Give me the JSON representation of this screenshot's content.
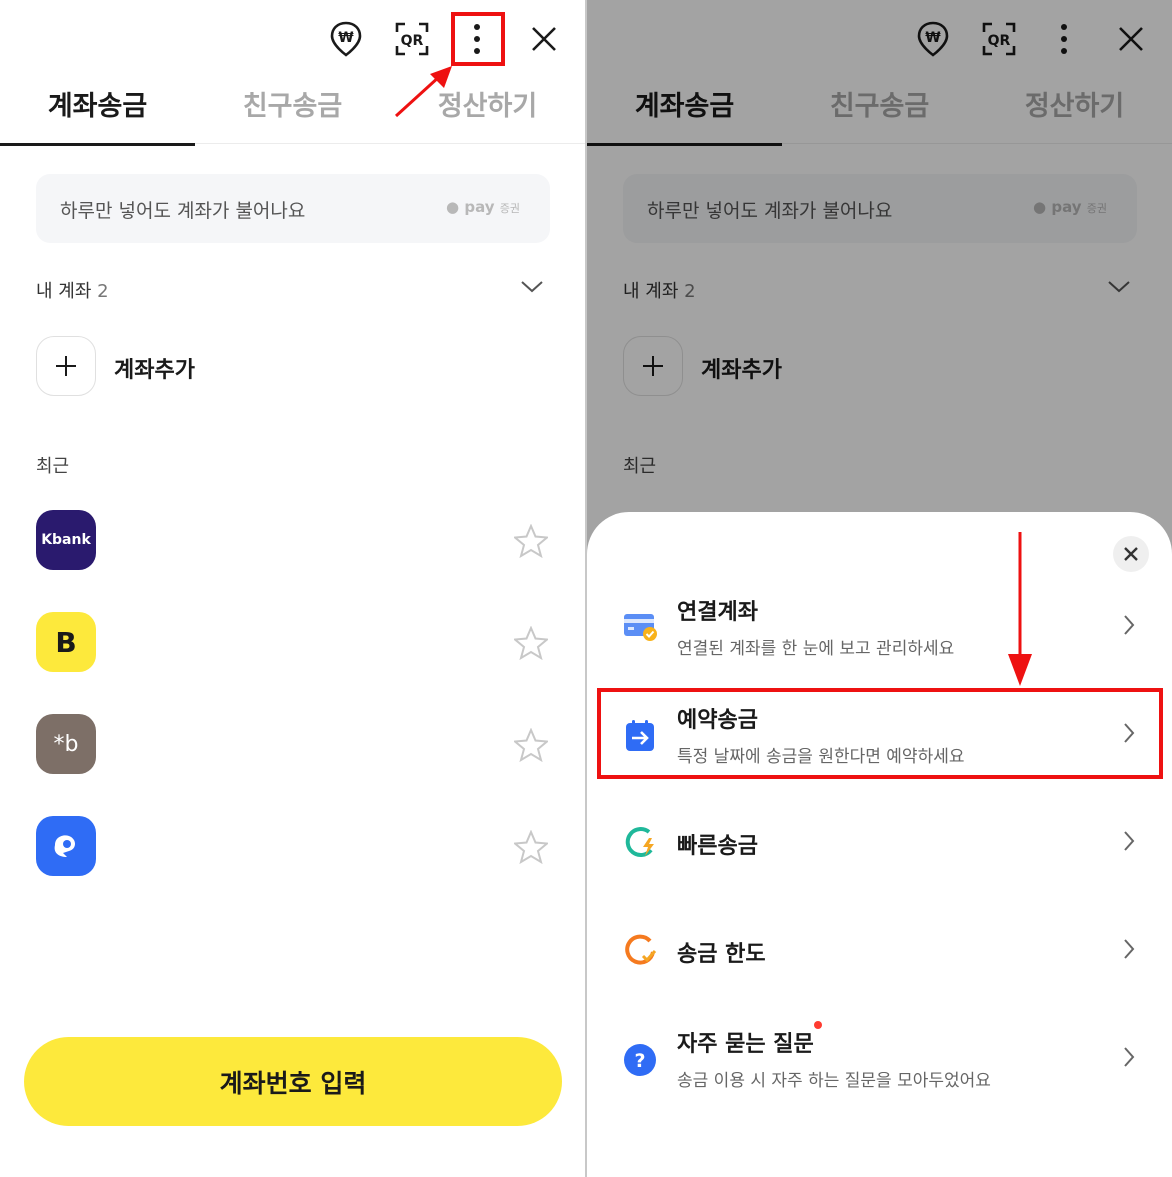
{
  "header": {
    "icons": [
      "won-pin-icon",
      "qr-icon",
      "more-vertical-icon",
      "close-icon"
    ],
    "qr_label": "QR"
  },
  "tabs": [
    {
      "label": "계좌송금",
      "active": true
    },
    {
      "label": "친구송금",
      "active": false
    },
    {
      "label": "정산하기",
      "active": false
    }
  ],
  "banner": {
    "text": "하루만 넣어도 계좌가 불어나요",
    "badge": "pay",
    "badge_suffix": "증권"
  },
  "my_accounts": {
    "label": "내 계좌",
    "count": "2"
  },
  "add_account": {
    "label": "계좌추가"
  },
  "recent": {
    "title": "최근",
    "items": [
      {
        "bank": "Kbank",
        "logo_text": "Kbank",
        "color": "#2a1a6e"
      },
      {
        "bank": "Kakao Bank",
        "logo_text": "B",
        "color": "#fde93c"
      },
      {
        "bank": "KB",
        "logo_text": "*b",
        "color": "#7d6f67"
      },
      {
        "bank": "Toss",
        "logo_text": "",
        "color": "#2f6cf5"
      }
    ]
  },
  "cta": {
    "label": "계좌번호 입력"
  },
  "sheet": {
    "items": [
      {
        "title": "연결계좌",
        "subtitle": "연결된 계좌를 한 눈에 보고 관리하세요",
        "icon": "card-check-icon"
      },
      {
        "title": "예약송금",
        "subtitle": "특정 날짜에 송금을 원한다면 예약하세요",
        "icon": "calendar-arrow-icon"
      },
      {
        "title": "빠른송금",
        "subtitle": "",
        "icon": "fast-transfer-icon"
      },
      {
        "title": "송금 한도",
        "subtitle": "",
        "icon": "limit-check-icon"
      },
      {
        "title": "자주 묻는 질문",
        "subtitle": "송금 이용 시 자주 하는 질문을 모아두었어요",
        "icon": "question-icon",
        "has_new_dot": true
      }
    ]
  },
  "colors": {
    "accent_yellow": "#fde93c",
    "highlight_red": "#ee1111",
    "text_dark": "#1a1a1a",
    "tab_inactive": "#a8a8a8"
  }
}
